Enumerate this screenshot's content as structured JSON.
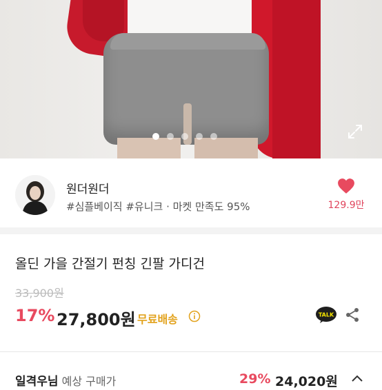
{
  "hero": {
    "slide_count": 5,
    "active_slide": 0
  },
  "seller": {
    "name": "원더원더",
    "tags": "#심플베이직 #유니크 · 마켓 만족도 95%",
    "like_count": "129.9만"
  },
  "product": {
    "title": "올딘 가을 간절기 펀칭 긴팔 가디건",
    "original_price": "33,900원",
    "discount": "17%",
    "price": "27,800원",
    "shipping": "무료배송"
  },
  "bottom_bar": {
    "grade_label": "일격우님",
    "grade_sub": " 예상 구매가",
    "discount": "29%",
    "price": "24,020원"
  },
  "colors": {
    "accent": "#e84a5f",
    "shipping": "#e2a21c"
  }
}
